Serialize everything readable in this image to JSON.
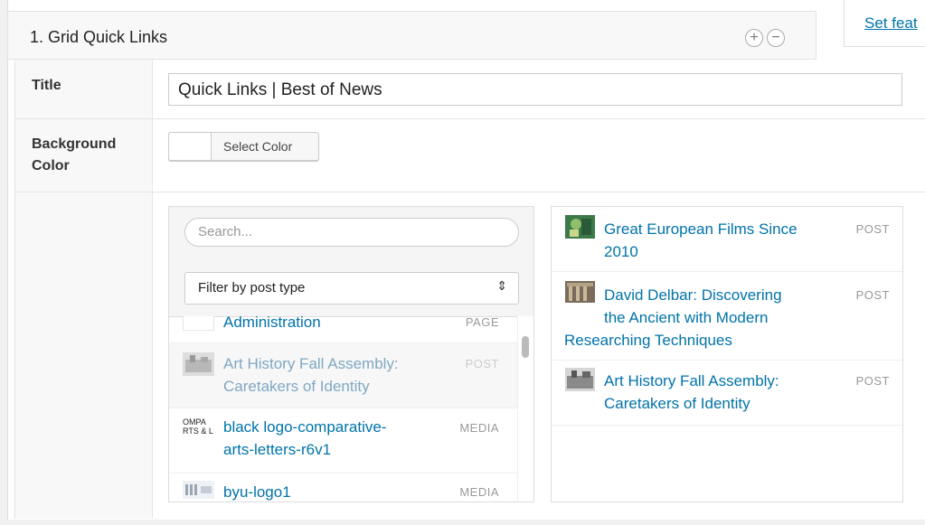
{
  "widget": {
    "title": "1. Grid Quick Links",
    "add_icon": "plus-circle-icon",
    "remove_icon": "minus-circle-icon",
    "side_link": "Set feat"
  },
  "fields": {
    "title_label": "Title",
    "title_value": "Quick Links | Best of News",
    "bg_label_line1": "Background",
    "bg_label_line2": "Color",
    "select_color_label": "Select Color",
    "swatch_color": "#ffffff"
  },
  "picker": {
    "search_placeholder": "Search...",
    "filter_selected": "Filter by post type",
    "filter_icon": "updown-arrows-icon",
    "items": [
      {
        "line1": "Administration",
        "line2": "",
        "type": "PAGE",
        "thumb": "blank"
      },
      {
        "line1": "Art History Fall Assembly:",
        "line2": "Caretakers of Identity",
        "type": "POST",
        "thumb": "photo"
      },
      {
        "line1": "black logo-comparative-",
        "line2": "arts-letters-r6v1",
        "type": "MEDIA",
        "thumb": "logo-text"
      },
      {
        "line1": "byu-logo1",
        "line2": "",
        "type": "MEDIA",
        "thumb": "logo"
      }
    ],
    "logo_thumb_text": [
      "OMPA",
      "RTS & L"
    ]
  },
  "selected": {
    "items": [
      {
        "line1": "Great European Films Since",
        "line2": "2010",
        "line3": "",
        "type": "POST",
        "thumb": "green-photo"
      },
      {
        "line1": "David Delbar: Discovering",
        "line2": "the Ancient with Modern",
        "line3": "Researching Techniques",
        "type": "POST",
        "thumb": "building-photo"
      },
      {
        "line1": "Art History Fall Assembly:",
        "line2": "Caretakers of Identity",
        "line3": "",
        "type": "POST",
        "thumb": "photo"
      }
    ]
  },
  "colors": {
    "link": "#0073aa",
    "muted": "#999999",
    "border": "#dddddd"
  }
}
